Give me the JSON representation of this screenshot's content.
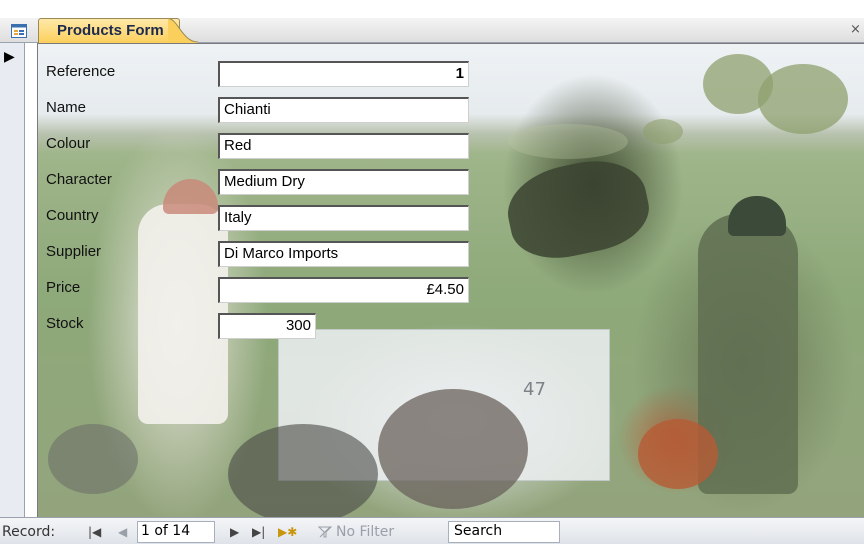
{
  "tab": {
    "title": "Products Form",
    "close_glyph": "×"
  },
  "icons": {
    "form_icon": "form-icon",
    "record_pointer": "▶"
  },
  "fields": [
    {
      "label": "Reference",
      "value": "1"
    },
    {
      "label": "Name",
      "value": "Chianti"
    },
    {
      "label": "Colour",
      "value": "Red"
    },
    {
      "label": "Character",
      "value": "Medium Dry"
    },
    {
      "label": "Country",
      "value": "Italy"
    },
    {
      "label": "Supplier",
      "value": "Di Marco Imports"
    },
    {
      "label": "Price",
      "value": "£4.50"
    },
    {
      "label": "Stock",
      "value": "300"
    }
  ],
  "navigation": {
    "record_label": "Record:",
    "first_glyph": "|◀",
    "prev_glyph": "◀",
    "record_value": "1 of 14",
    "next_glyph": "▶",
    "last_glyph": "▶|",
    "new_glyph": "▶✱",
    "no_filter_label": "No Filter",
    "search_label": "Search"
  },
  "colors": {
    "tab_active": "#fbcf5c",
    "tab_text": "#1d2a4e",
    "accent_orange": "#e8a33b"
  }
}
